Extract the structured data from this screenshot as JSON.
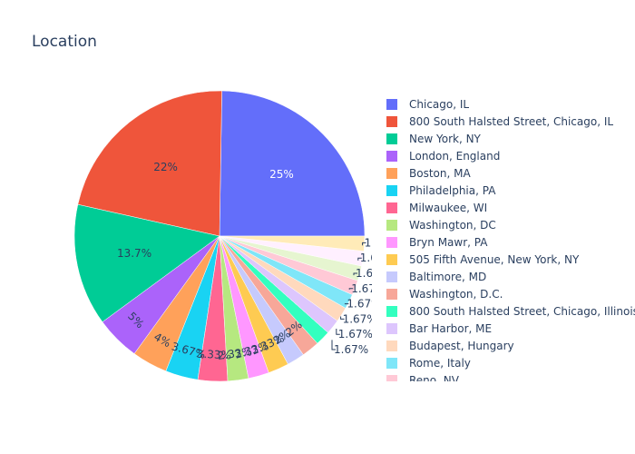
{
  "chart_data": {
    "type": "pie",
    "title": "Location",
    "direction": "counterclockwise",
    "legend_position": "right",
    "slices": [
      {
        "label": "Chicago, IL",
        "value": 25,
        "text": "25%",
        "color": "#636EFA"
      },
      {
        "label": "800 South Halsted Street, Chicago, IL",
        "value": 22,
        "text": "22%",
        "color": "#EF553B"
      },
      {
        "label": "New York, NY",
        "value": 13.7,
        "text": "13.7%",
        "color": "#00CC96"
      },
      {
        "label": "London, England",
        "value": 5,
        "text": "5%",
        "color": "#AB63FA"
      },
      {
        "label": "Boston, MA",
        "value": 4,
        "text": "4%",
        "color": "#FFA15A"
      },
      {
        "label": "Philadelphia, PA",
        "value": 3.67,
        "text": "3.67%",
        "color": "#19D3F3"
      },
      {
        "label": "Milwaukee, WI",
        "value": 3.33,
        "text": "3.33%",
        "color": "#FF6692"
      },
      {
        "label": "Washington, DC",
        "value": 2.33,
        "text": "2.33%",
        "color": "#B6E880"
      },
      {
        "label": "Bryn Mawr, PA",
        "value": 2.33,
        "text": "2.33%",
        "color": "#FF97FF"
      },
      {
        "label": "505 Fifth Avenue, New York, NY",
        "value": 2.33,
        "text": "2.33%",
        "color": "#FECB52"
      },
      {
        "label": "Baltimore, MD",
        "value": 2,
        "text": "2%",
        "color": "#C6CAFD"
      },
      {
        "label": "Washington, D.C.",
        "value": 2,
        "text": "2%",
        "color": "#F7A799"
      },
      {
        "label": "800 South Halsted Street, Chicago, Illinois",
        "value": 1.67,
        "text": "1.67%",
        "color": "#33FFBF"
      },
      {
        "label": "Bar Harbor, ME",
        "value": 1.67,
        "text": "1.67%",
        "color": "#DDC6FD"
      },
      {
        "label": "Budapest, Hungary",
        "value": 1.67,
        "text": "1.67%",
        "color": "#FFD9BD"
      },
      {
        "label": "Rome, Italy",
        "value": 1.67,
        "text": "1.67%",
        "color": "#7FE6F8"
      },
      {
        "label": "Reno, NV",
        "value": 1.67,
        "text": "1.67%",
        "color": "#FFC9D6"
      },
      {
        "label": "",
        "value": 1.67,
        "text": "1.67%",
        "color": "#E6F5D0"
      },
      {
        "label": "",
        "value": 1.67,
        "text": "1.67%",
        "color": "#FFF0FF"
      },
      {
        "label": "",
        "value": 1.67,
        "text": "1.67%",
        "color": "#FFEBB8"
      }
    ]
  }
}
